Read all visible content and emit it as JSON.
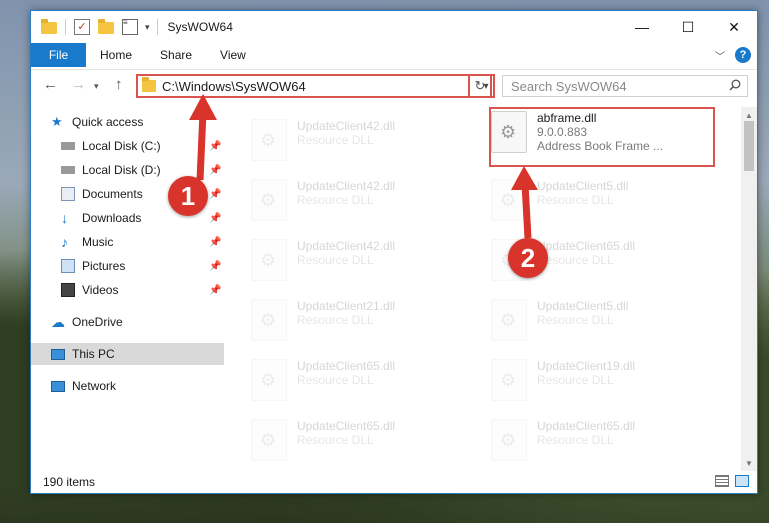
{
  "window": {
    "title": "SysWOW64",
    "controls": {
      "minimize": "—",
      "maximize": "☐",
      "close": "✕"
    }
  },
  "ribbon": {
    "tabs": [
      "File",
      "Home",
      "Share",
      "View"
    ],
    "help": "?"
  },
  "nav": {
    "address": "C:\\Windows\\SysWOW64",
    "search_placeholder": "Search SysWOW64"
  },
  "sidebar": {
    "items": [
      {
        "label": "Quick access",
        "icon": "star-icon"
      },
      {
        "label": "Local Disk (C:)",
        "icon": "drive-icon",
        "pinned": true
      },
      {
        "label": "Local Disk (D:)",
        "icon": "drive-icon",
        "pinned": true
      },
      {
        "label": "Documents",
        "icon": "documents-icon",
        "pinned": true
      },
      {
        "label": "Downloads",
        "icon": "download-icon",
        "pinned": true
      },
      {
        "label": "Music",
        "icon": "music-icon",
        "pinned": true
      },
      {
        "label": "Pictures",
        "icon": "pictures-icon",
        "pinned": true
      },
      {
        "label": "Videos",
        "icon": "videos-icon",
        "pinned": true
      },
      {
        "label": "OneDrive",
        "icon": "cloud-icon"
      },
      {
        "label": "This PC",
        "icon": "computer-icon",
        "selected": true
      },
      {
        "label": "Network",
        "icon": "network-icon"
      }
    ]
  },
  "files": {
    "selected": {
      "name": "abframe.dll",
      "version": "9.0.0.883",
      "description": "Address Book Frame ..."
    },
    "left_column": [
      {
        "name": "UpdateClient42.dll",
        "type": "Resource DLL"
      },
      {
        "name": "UpdateClient42.dll",
        "type": "Resource DLL"
      },
      {
        "name": "UpdateClient42.dll",
        "type": "Resource DLL"
      },
      {
        "name": "UpdateClient21.dll",
        "type": "Resource DLL"
      },
      {
        "name": "UpdateClient65.dll",
        "type": "Resource DLL"
      },
      {
        "name": "UpdateClient65.dll",
        "type": "Resource DLL"
      }
    ],
    "right_column": [
      {
        "name": "UpdateClient5.dll",
        "type": "Resource DLL"
      },
      {
        "name": "UpdateClient65.dll",
        "type": "Resource DLL"
      },
      {
        "name": "UpdateClient5.dll",
        "type": "Resource DLL"
      },
      {
        "name": "UpdateClient19.dll",
        "type": "Resource DLL"
      },
      {
        "name": "UpdateClient65.dll",
        "type": "Resource DLL"
      }
    ]
  },
  "status": {
    "item_count": "190 items"
  },
  "annotations": {
    "step1": "1",
    "step2": "2"
  },
  "colors": {
    "accent": "#1979ca",
    "highlight_red": "#d9534f",
    "marker_red": "#d9342b"
  }
}
